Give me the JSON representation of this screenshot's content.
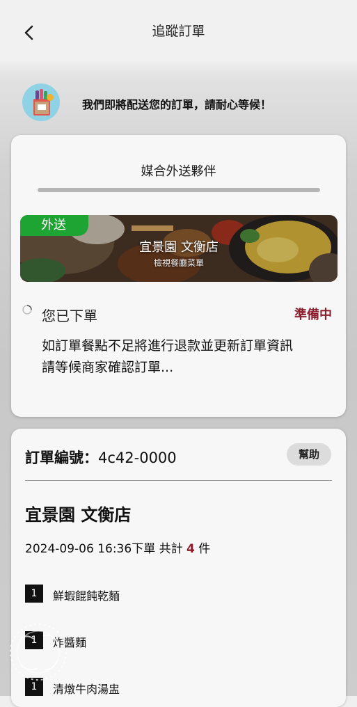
{
  "header": {
    "title": "追蹤訂單",
    "back_icon": "chevron-left-icon"
  },
  "notice": {
    "icon": "shopping-bag-icon",
    "text": "我們即將配送您的訂單，請耐心等候！"
  },
  "tracking": {
    "match_label": "媒合外送夥伴",
    "restaurant": {
      "tag": "外送",
      "name": "宜景園 文衡店",
      "menu_link": "檢視餐廳菜單"
    },
    "status": {
      "label": "您已下單",
      "badge": "準備中",
      "badge_color": "#8b1e2d"
    },
    "info": "如訂單餐點不足將進行退款並更新訂單資訊\n請等候商家確認訂單..."
  },
  "order": {
    "number_label": "訂單編號：",
    "number": "4c42-0000",
    "help_label": "幫助",
    "store_name": "宜景園 文衡店",
    "placed_prefix": "2024-09-06 16:36下單 共計 ",
    "item_count": "4",
    "item_unit": " 件",
    "items": [
      {
        "qty": "1",
        "name": "鮮蝦餛飩乾麵"
      },
      {
        "qty": "1",
        "name": "炸醬麵"
      },
      {
        "qty": "1",
        "name": "清燉牛肉湯盅"
      }
    ]
  },
  "colors": {
    "accent_green": "#1ea433",
    "status_red": "#8b1e2d"
  }
}
